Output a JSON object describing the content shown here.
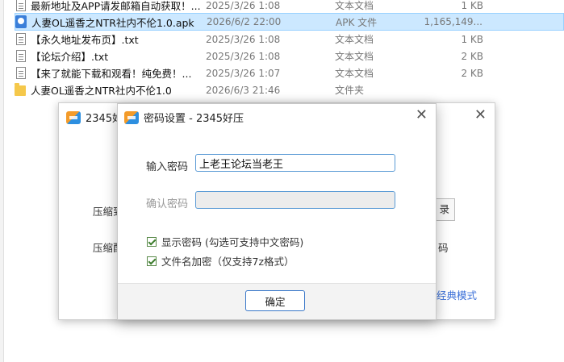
{
  "files": [
    {
      "name": "最新地址及APP请发邮箱自动获取！...",
      "date": "2025/3/26 1:08",
      "type": "文本文档",
      "size": "1 KB",
      "icon": "txt-file-icon"
    },
    {
      "name": "人妻OL遥香之NTR社内不伦1.0.apk",
      "date": "2026/6/2 22:00",
      "type": "APK 文件",
      "size": "1,165,149...",
      "icon": "apk-file-icon"
    },
    {
      "name": "【永久地址发布页】.txt",
      "date": "2025/3/26 1:08",
      "type": "文本文档",
      "size": "1 KB",
      "icon": "txt-file-icon"
    },
    {
      "name": "【论坛介绍】.txt",
      "date": "2025/3/26 1:08",
      "type": "文本文档",
      "size": "2 KB",
      "icon": "txt-file-icon"
    },
    {
      "name": "【来了就能下载和观看！纯免费！...",
      "date": "2025/3/26 1:07",
      "type": "文本文档",
      "size": "2 KB",
      "icon": "txt-file-icon"
    },
    {
      "name": "人妻OL遥香之NTR社内不伦1.0",
      "date": "2026/6/3 21:46",
      "type": "文件夹",
      "size": "",
      "icon": "folder-icon"
    }
  ],
  "back_window": {
    "title": "2345好",
    "label_1": "压缩到",
    "label_2": "压缩配",
    "button_tail": "录",
    "text_tail": "码",
    "link": "经典模式"
  },
  "dialog": {
    "title": "密码设置 - 2345好压",
    "password_label": "输入密码",
    "password_value": "上老王论坛当老王",
    "confirm_label": "确认密码",
    "confirm_value": "",
    "show_password": "显示密码 (勾选可支持中文密码)",
    "encrypt_names": "文件名加密（仅支持7z格式）",
    "ok": "确定"
  }
}
